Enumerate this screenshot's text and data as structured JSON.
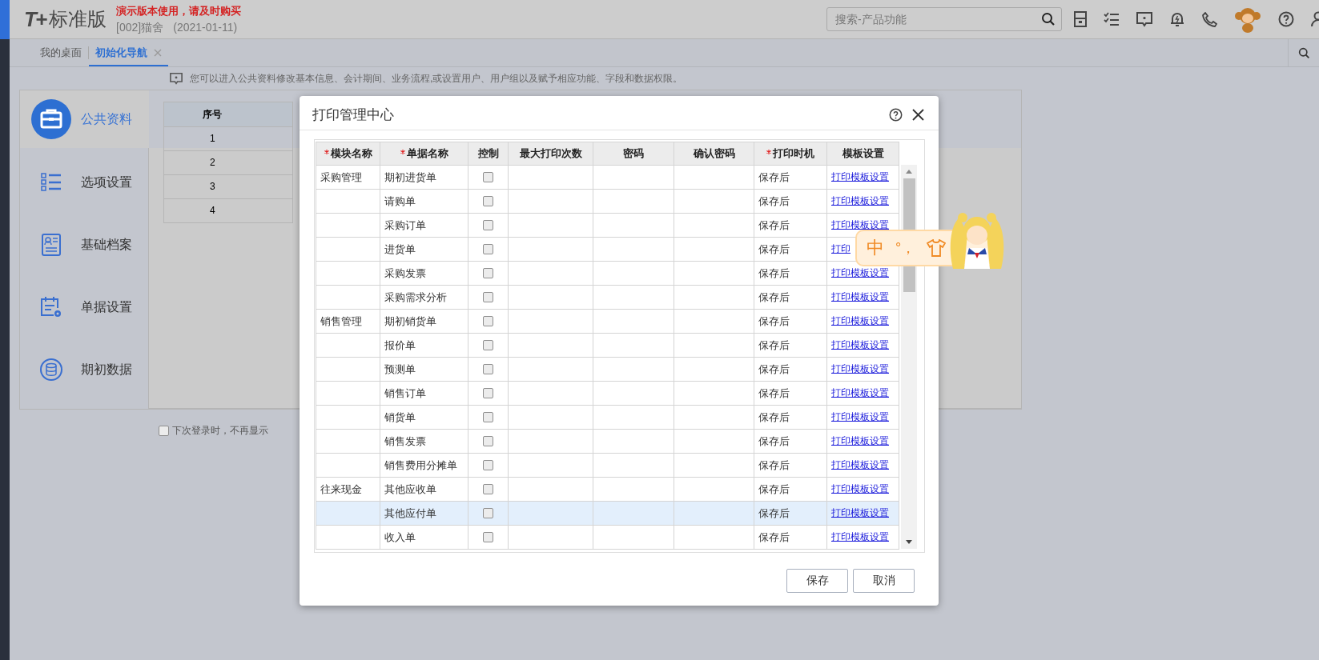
{
  "header": {
    "logo_mark": "T+",
    "product": "标准版",
    "demo_notice": "演示版本使用，请及时购买",
    "account": "[002]猫舍",
    "date": "(2021-01-11)",
    "search": {
      "placeholder": "搜索-产品功能"
    }
  },
  "tabs": [
    {
      "label": "我的桌面",
      "selected": false,
      "closable": false
    },
    {
      "label": "初始化导航",
      "selected": true,
      "closable": true
    }
  ],
  "hint": "您可以进入公共资料修改基本信息、会计期间、业务流程,或设置用户、用户组以及赋予相应功能、字段和数据权限。",
  "nav": [
    {
      "label": "公共资料",
      "kind": "briefcase",
      "selected": true
    },
    {
      "label": "选项设置",
      "kind": "checklist",
      "selected": false
    },
    {
      "label": "基础档案",
      "kind": "card",
      "selected": false
    },
    {
      "label": "单据设置",
      "kind": "calendar",
      "selected": false
    },
    {
      "label": "期初数据",
      "kind": "database",
      "selected": false
    }
  ],
  "grid": {
    "column": "序号",
    "rows": [
      "1",
      "2",
      "3",
      "4"
    ]
  },
  "dont_show": {
    "label": "下次登录时，不再显示",
    "checked": false
  },
  "dialog": {
    "title": "打印管理中心",
    "columns": [
      {
        "label": "模块名称",
        "required": true
      },
      {
        "label": "单据名称",
        "required": true
      },
      {
        "label": "控制",
        "required": false
      },
      {
        "label": "最大打印次数",
        "required": false
      },
      {
        "label": "密码",
        "required": false
      },
      {
        "label": "确认密码",
        "required": false
      },
      {
        "label": "打印时机",
        "required": true
      },
      {
        "label": "模板设置",
        "required": false
      }
    ],
    "rows": [
      {
        "module": "采购管理",
        "document": "期初进货单",
        "checked": false,
        "timing": "保存后",
        "link": "打印模板设置",
        "selected": false
      },
      {
        "document": "请购单",
        "checked": false,
        "timing": "保存后",
        "link": "打印模板设置",
        "selected": false
      },
      {
        "document": "采购订单",
        "checked": false,
        "timing": "保存后",
        "link": "打印模板设置",
        "selected": false
      },
      {
        "document": "进货单",
        "checked": false,
        "timing": "保存后",
        "link": "打印",
        "selected": false
      },
      {
        "document": "采购发票",
        "checked": false,
        "timing": "保存后",
        "link": "打印模板设置",
        "selected": false
      },
      {
        "document": "采购需求分析",
        "checked": false,
        "timing": "保存后",
        "link": "打印模板设置",
        "selected": false
      },
      {
        "module": "销售管理",
        "document": "期初销货单",
        "checked": false,
        "timing": "保存后",
        "link": "打印模板设置",
        "selected": false
      },
      {
        "document": "报价单",
        "checked": false,
        "timing": "保存后",
        "link": "打印模板设置",
        "selected": false
      },
      {
        "document": "预测单",
        "checked": false,
        "timing": "保存后",
        "link": "打印模板设置",
        "selected": false
      },
      {
        "document": "销售订单",
        "checked": false,
        "timing": "保存后",
        "link": "打印模板设置",
        "selected": false
      },
      {
        "document": "销货单",
        "checked": false,
        "timing": "保存后",
        "link": "打印模板设置",
        "selected": false
      },
      {
        "document": "销售发票",
        "checked": false,
        "timing": "保存后",
        "link": "打印模板设置",
        "selected": false
      },
      {
        "document": "销售费用分摊单",
        "checked": false,
        "timing": "保存后",
        "link": "打印模板设置",
        "selected": false
      },
      {
        "module": "往来现金",
        "document": "其他应收单",
        "checked": false,
        "timing": "保存后",
        "link": "打印模板设置",
        "selected": false
      },
      {
        "document": "其他应付单",
        "checked": false,
        "timing": "保存后",
        "link": "打印模板设置",
        "selected": true
      },
      {
        "document": "收入单",
        "checked": false,
        "timing": "保存后",
        "link": "打印模板设置",
        "selected": false
      }
    ],
    "buttons": [
      "保存",
      "取消"
    ]
  },
  "ime": {
    "mode": "中",
    "punctuation": "°，"
  }
}
